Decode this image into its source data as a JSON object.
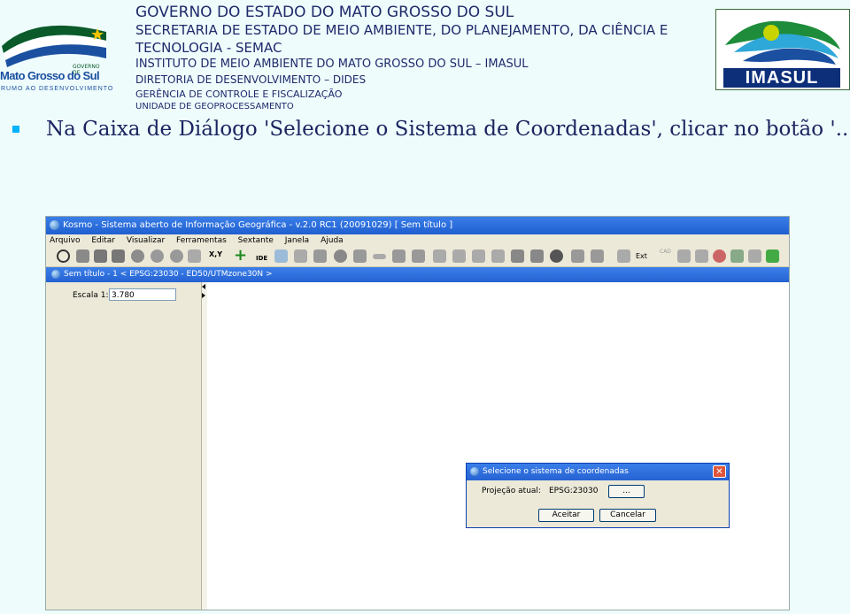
{
  "header": {
    "lines": [
      "GOVERNO DO ESTADO DO MATO GROSSO DO SUL",
      "SECRETARIA DE ESTADO DE MEIO AMBIENTE, DO PLANEJAMENTO, DA CIÊNCIA E",
      "TECNOLOGIA - SEMAC",
      "INSTITUTO DE MEIO AMBIENTE DO MATO GROSSO DO SUL – IMASUL",
      "DIRETORIA DE DESENVOLVIMENTO – DIDES",
      "GERÊNCIA DE CONTROLE E FISCALIZAÇÃO",
      "UNIDADE DE GEOPROCESSAMENTO"
    ],
    "logo_left": {
      "governo": "GOVERNO DE",
      "name": "Mato Grosso do Sul",
      "tagline": "RUMO AO DESENVOLVIMENTO"
    },
    "logo_right": "IMASUL"
  },
  "slide": {
    "instruction": "Na Caixa de Diálogo 'Selecione o Sistema de Coordenadas', clicar no botão '...';"
  },
  "app": {
    "title": "Kosmo - Sistema aberto de Informação Geográfica - v.2.0 RC1 (20091029)  [ Sem título ]",
    "menu": [
      "Arquivo",
      "Editar",
      "Visualizar",
      "Ferramentas",
      "Sextante",
      "Janela",
      "Ajuda"
    ],
    "toolbar_text": {
      "xy": "X,Y",
      "ide": "IDE",
      "ext": "Ext",
      "cad": "CAD"
    },
    "doc_title": "Sem título - 1 < EPSG:23030 - ED50/UTMzone30N >",
    "scale_label": "Escala 1:",
    "scale_value": "3.780"
  },
  "dialog": {
    "title": "Selecione o sistema de coordenadas",
    "projection_label": "Projeção atual:",
    "projection_value": "EPSG:23030",
    "browse_label": "...",
    "accept_label": "Aceitar",
    "cancel_label": "Cancelar",
    "close_label": "✕"
  }
}
